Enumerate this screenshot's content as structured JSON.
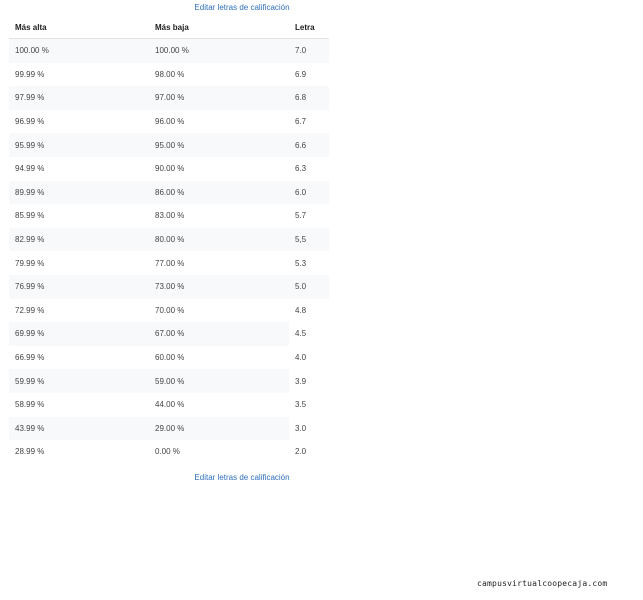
{
  "links": {
    "edit_top": "Editar letras de calificación",
    "edit_bottom": "Editar letras de calificación"
  },
  "table": {
    "headers": {
      "high": "Más alta",
      "low": "Más baja",
      "letter": "Letra"
    },
    "rows": [
      {
        "high": "100.00 %",
        "low": "100.00 %",
        "letter": "7.0"
      },
      {
        "high": "99.99 %",
        "low": "98.00 %",
        "letter": "6.9"
      },
      {
        "high": "97.99 %",
        "low": "97.00 %",
        "letter": "6.8"
      },
      {
        "high": "96.99 %",
        "low": "96.00 %",
        "letter": "6.7"
      },
      {
        "high": "95.99 %",
        "low": "95.00 %",
        "letter": "6.6"
      },
      {
        "high": "94.99 %",
        "low": "90.00 %",
        "letter": "6.3"
      },
      {
        "high": "89.99 %",
        "low": "86.00 %",
        "letter": "6.0"
      },
      {
        "high": "85.99 %",
        "low": "83.00 %",
        "letter": "5.7"
      },
      {
        "high": "82.99 %",
        "low": "80.00 %",
        "letter": "5,5"
      },
      {
        "high": "79.99 %",
        "low": "77.00 %",
        "letter": "5.3"
      },
      {
        "high": "76.99 %",
        "low": "73.00 %",
        "letter": "5.0"
      },
      {
        "high": "72.99 %",
        "low": "70.00 %",
        "letter": "4.8"
      },
      {
        "high": "69.99 %",
        "low": "67.00 %",
        "letter": "4.5"
      },
      {
        "high": "66.99 %",
        "low": "60.00 %",
        "letter": "4.0"
      },
      {
        "high": "59.99 %",
        "low": "59.00 %",
        "letter": "3.9"
      },
      {
        "high": "58.99 %",
        "low": "44.00 %",
        "letter": "3.5"
      },
      {
        "high": "43.99 %",
        "low": "29.00 %",
        "letter": "3.0"
      },
      {
        "high": "28.99 %",
        "low": "0.00 %",
        "letter": "2.0"
      }
    ]
  },
  "watermark": {
    "text": "campusvirtualcoopecaja.com"
  },
  "colors": {
    "link": "#2f6fbd",
    "stripe": "#f8f9fb",
    "header_text": "#1d1d1d"
  }
}
